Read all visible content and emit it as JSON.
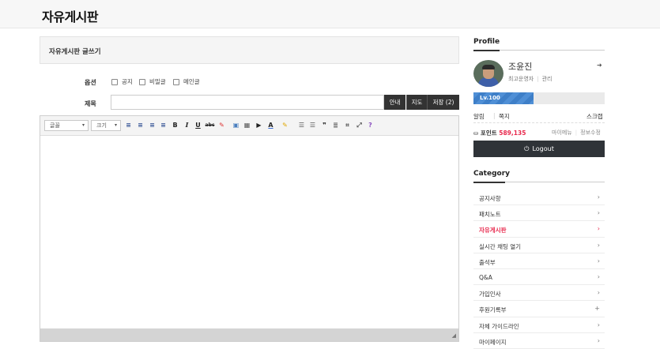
{
  "site": {
    "title": "자유게시판"
  },
  "write": {
    "heading": "자유게시판 글쓰기",
    "options_label": "옵션",
    "options": [
      "공지",
      "비밀글",
      "메인글"
    ],
    "subject_label": "제목",
    "subject_value": "",
    "buttons": {
      "guide": "안내",
      "map": "지도",
      "save": "저장 (2)"
    }
  },
  "editor": {
    "font_select": "글꼴",
    "size_select": "크기",
    "tool_icons": [
      "align-left-icon",
      "align-center-icon",
      "align-right-icon",
      "align-justify-icon",
      "bold-icon",
      "italic-icon",
      "underline-icon",
      "strike-icon",
      "eraser-icon",
      "image-icon",
      "table-icon",
      "video-icon",
      "font-color-icon",
      "highlight-icon",
      "ordered-list-icon",
      "unordered-list-icon",
      "quote-icon",
      "hr-icon",
      "source-icon",
      "fullscreen-icon",
      "help-icon"
    ]
  },
  "profile": {
    "heading": "Profile",
    "name": "조윤진",
    "role": "최고운영자",
    "admin": "관리",
    "level": "Lv.100",
    "level_fraction": 0.46,
    "alarm": "알림",
    "memo": "쪽지",
    "scrap": "스크랩",
    "point_label": "포인트",
    "point_value": "589,135",
    "my_menu": "마이메뉴",
    "edit_info": "정보수정",
    "logout": "Logout"
  },
  "category": {
    "heading": "Category",
    "items": [
      {
        "label": "공지사항",
        "chev": "›"
      },
      {
        "label": "패치노트",
        "chev": "›"
      },
      {
        "label": "자유게시판",
        "chev": "›",
        "active": true
      },
      {
        "label": "실시간 채팅 열기",
        "chev": "›"
      },
      {
        "label": "출석부",
        "chev": "›"
      },
      {
        "label": "Q&A",
        "chev": "›"
      },
      {
        "label": "가입인사",
        "chev": "›"
      },
      {
        "label": "후원기록부",
        "chev": "+"
      },
      {
        "label": "자체 가이드라인",
        "chev": "›"
      },
      {
        "label": "마이페이지",
        "chev": "›"
      }
    ]
  }
}
